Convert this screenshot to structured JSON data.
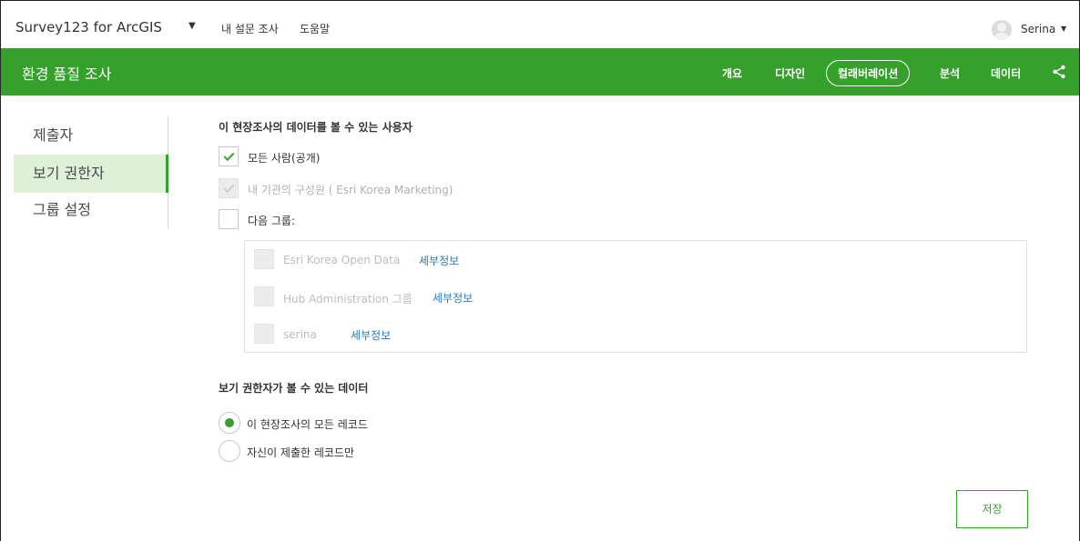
{
  "topbar": {
    "app_title": "Survey123 for ArcGIS",
    "links": [
      "내 설문 조사",
      "도움말"
    ],
    "user_name": "Serina"
  },
  "greenbar": {
    "survey_title": "환경 품질 조사",
    "tabs": [
      {
        "label": "개요",
        "active": false
      },
      {
        "label": "디자인",
        "active": false
      },
      {
        "label": "컬래버레이션",
        "active": true
      },
      {
        "label": "분석",
        "active": false
      },
      {
        "label": "데이터",
        "active": false
      }
    ],
    "share_icon": "share-icon"
  },
  "left_nav": {
    "items": [
      {
        "label": "제출자",
        "active": false
      },
      {
        "label": "보기 권한자",
        "active": true
      },
      {
        "label": "그룹 설정",
        "active": false
      }
    ]
  },
  "viewers": {
    "heading": "이 현장조사의 데이터를 볼 수 있는 사용자",
    "options": [
      {
        "label": "모든 사람(공개)",
        "checked": true,
        "disabled": false
      },
      {
        "label": "내 기관의 구성원 ( Esri Korea Marketing)",
        "checked": true,
        "disabled": true
      },
      {
        "label": "다음 그룹:",
        "checked": false,
        "disabled": false
      }
    ],
    "groups": [
      {
        "name": "Esri Korea Open Data",
        "link": "세부정보"
      },
      {
        "name": "Hub Administration 그룹",
        "link": "세부정보"
      },
      {
        "name": "serina",
        "link": "세부정보"
      }
    ]
  },
  "data_access": {
    "heading": "보기 권한자가 볼 수 있는 데이터",
    "options": [
      {
        "label": "이 현장조사의 모든 레코드",
        "selected": true
      },
      {
        "label": "자신이 제출한 레코드만",
        "selected": false
      }
    ]
  },
  "actions": {
    "save_label": "저장"
  },
  "colors": {
    "brand_green": "#35a02c",
    "nav_active_bg": "#dff0d8",
    "link_blue": "#2a7ab8"
  }
}
